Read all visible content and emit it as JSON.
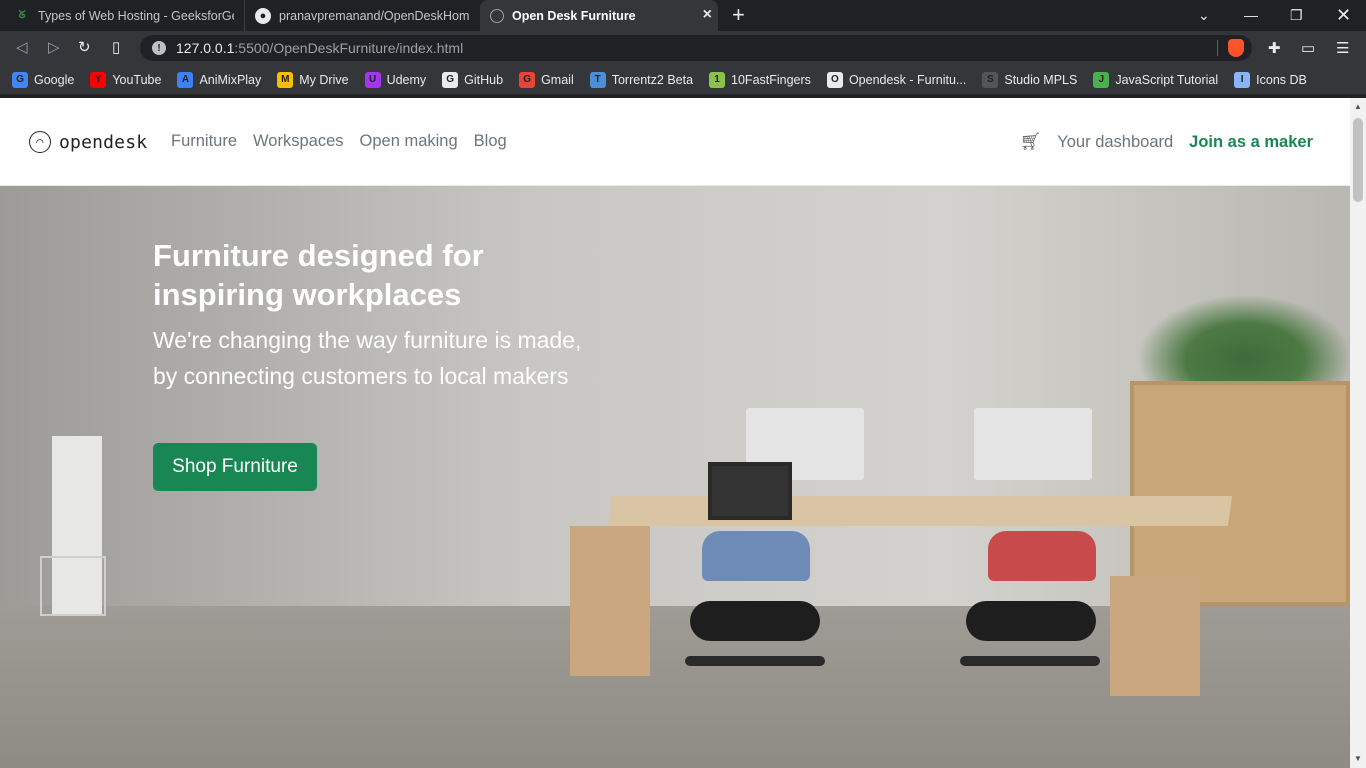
{
  "browser": {
    "tabs": [
      {
        "title": "Types of Web Hosting - GeeksforGeek",
        "icon": "geeksforgeeks-icon"
      },
      {
        "title": "pranavpremanand/OpenDeskHomePa",
        "icon": "github-icon"
      },
      {
        "title": "Open Desk Furniture",
        "icon": "globe-icon"
      }
    ],
    "address": {
      "host": "127.0.0.1",
      "path": ":5500/OpenDeskFurniture/index.html"
    },
    "bookmarks": [
      {
        "label": "Google",
        "icon": "google-icon",
        "color": "#4285f4"
      },
      {
        "label": "YouTube",
        "icon": "youtube-icon",
        "color": "#ff0000"
      },
      {
        "label": "AniMixPlay",
        "icon": "animixplay-icon",
        "color": "#3b82f6"
      },
      {
        "label": "My Drive",
        "icon": "drive-icon",
        "color": "#fbbc04"
      },
      {
        "label": "Udemy",
        "icon": "udemy-icon",
        "color": "#a435f0"
      },
      {
        "label": "GitHub",
        "icon": "github-icon",
        "color": "#e8eaed"
      },
      {
        "label": "Gmail",
        "icon": "gmail-icon",
        "color": "#ea4335"
      },
      {
        "label": "Torrentz2 Beta",
        "icon": "torrentz-icon",
        "color": "#4a90d9"
      },
      {
        "label": "10FastFingers",
        "icon": "tenfastfingers-icon",
        "color": "#8bc34a"
      },
      {
        "label": "Opendesk - Furnitu...",
        "icon": "opendesk-icon",
        "color": "#e8eaed"
      },
      {
        "label": "Studio MPLS",
        "icon": "studio-mpls-icon",
        "color": "#555555"
      },
      {
        "label": "JavaScript Tutorial",
        "icon": "w3-icon",
        "color": "#4caf50"
      },
      {
        "label": "Icons DB",
        "icon": "heart-icon",
        "color": "#8ab4f8"
      }
    ]
  },
  "site": {
    "logo_text": "opendesk",
    "nav": [
      "Furniture",
      "Workspaces",
      "Open making",
      "Blog"
    ],
    "dashboard": "Your dashboard",
    "join": "Join as a maker",
    "accent": "#198754"
  },
  "hero": {
    "title": "Furniture designed for inspiring workplaces",
    "subtitle": "We're changing the way furniture is made, by connecting customers to local makers",
    "cta": "Shop Furniture"
  }
}
